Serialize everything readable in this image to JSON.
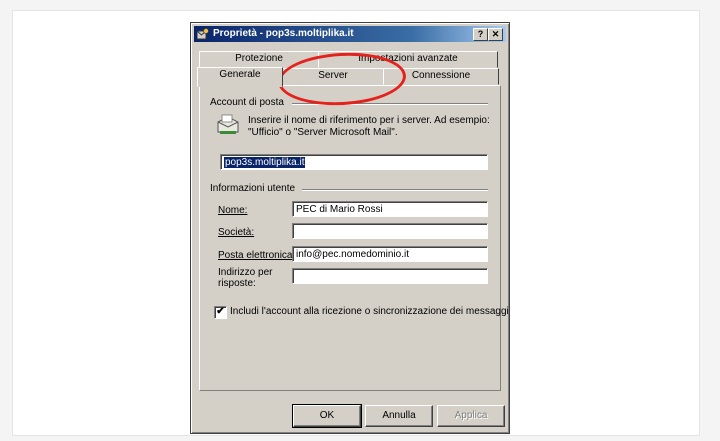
{
  "window": {
    "title": "Proprietà - pop3s.moltiplika.it",
    "help_label": "?",
    "close_label": "✕"
  },
  "tabs": {
    "top_row": [
      "Protezione",
      "Impostazioni avanzate"
    ],
    "bottom_row": [
      "Generale",
      "Server",
      "Connessione"
    ],
    "active": "Generale",
    "highlighted": "Server"
  },
  "account": {
    "group_label": "Account di posta",
    "description": "Inserire il nome di riferimento per i server. Ad esempio: \"Ufficio\" o \"Server Microsoft Mail\".",
    "name_value": "pop3s.moltiplika.it"
  },
  "user_info": {
    "group_label": "Informazioni utente",
    "name_label": "Nome:",
    "name_value": "PEC di Mario Rossi",
    "company_label": "Società:",
    "company_value": "",
    "email_label": "Posta elettronica:",
    "email_value": "info@pec.nomedominio.it",
    "reply_label_1": "Indirizzo per",
    "reply_label_2": "risposte:",
    "reply_value": ""
  },
  "include_checkbox": {
    "label": "Includi l'account alla ricezione o sincronizzazione dei messaggi",
    "checked": true,
    "mark": "✔"
  },
  "buttons": {
    "ok": "OK",
    "cancel": "Annulla",
    "apply": "Applica"
  },
  "colors": {
    "highlight_circle": "#e5211c",
    "title_bar": "#0a246a",
    "dialog_face": "#d4d0c8"
  }
}
